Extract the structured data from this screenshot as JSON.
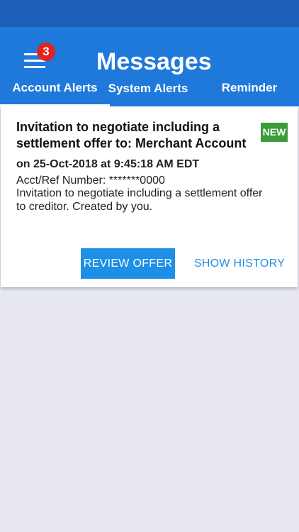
{
  "header": {
    "title": "Messages",
    "menu_badge_count": "3"
  },
  "tabs": [
    {
      "label": "Account Alerts",
      "active": true
    },
    {
      "label": "System Alerts",
      "active": false
    },
    {
      "label": "Reminder",
      "active": false
    }
  ],
  "message": {
    "title": "Invitation to negotiate including a settlement offer to: Merchant Account",
    "badge": "NEW",
    "date": "on 25-Oct-2018 at 9:45:18 AM EDT",
    "acct": "Acct/Ref Number: *******0000",
    "description": "Invitation to negotiate including a settlement offer to creditor. Created by you.",
    "review_label": "REVIEW OFFER",
    "history_label": "SHOW HISTORY"
  },
  "colors": {
    "statusbar": "#1b5fb8",
    "appbar": "#1f79db",
    "accent": "#1d8fe6",
    "badge_red": "#e4221f",
    "new_green": "#3a9c3b",
    "background": "#e7e8f1"
  }
}
